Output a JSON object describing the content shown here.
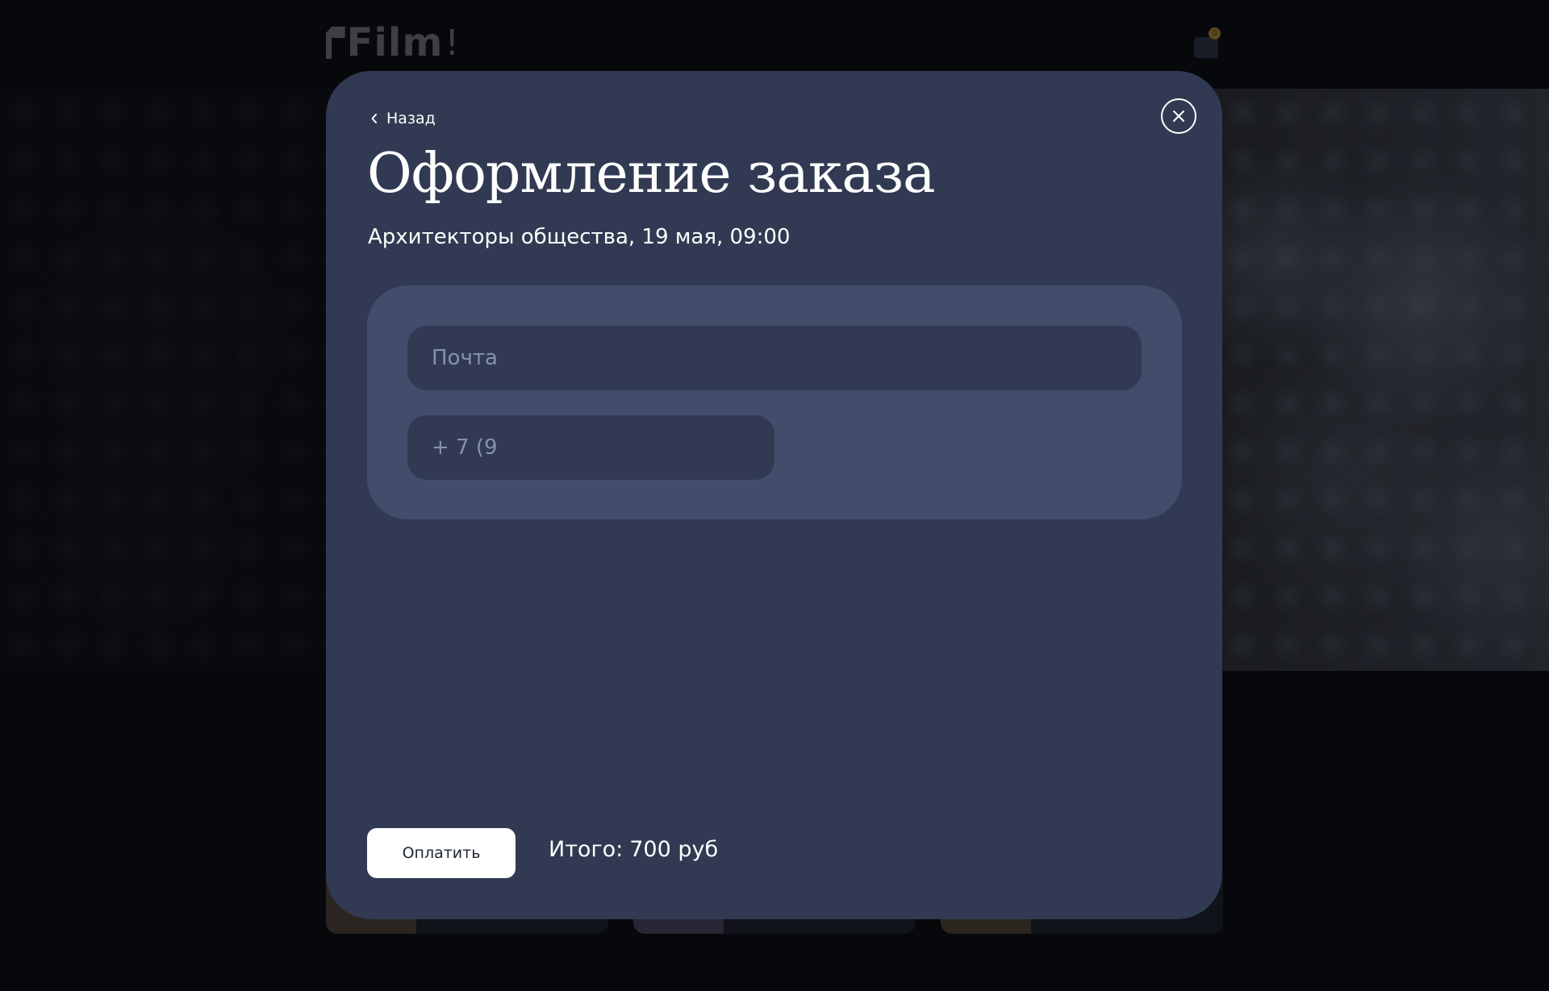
{
  "site": {
    "logo_text": "Film",
    "logo_bang": "!",
    "cart_count": "0"
  },
  "modal": {
    "back_label": "Назад",
    "title": "Оформление заказа",
    "subtitle": "Архитекторы общества, 19 мая, 09:00",
    "email_placeholder": "Почта",
    "phone_value": "+ 7 (9",
    "pay_label": "Оплатить",
    "total_label": "Итого:",
    "total_value": "700 руб"
  },
  "icons": {
    "back": "chevron-left-icon",
    "close": "close-icon",
    "cart": "cart-icon"
  },
  "colors": {
    "modal_bg": "#313a52",
    "form_card_bg": "#424d6b",
    "page_bg": "#07080c",
    "button_bg": "#ffffff"
  }
}
